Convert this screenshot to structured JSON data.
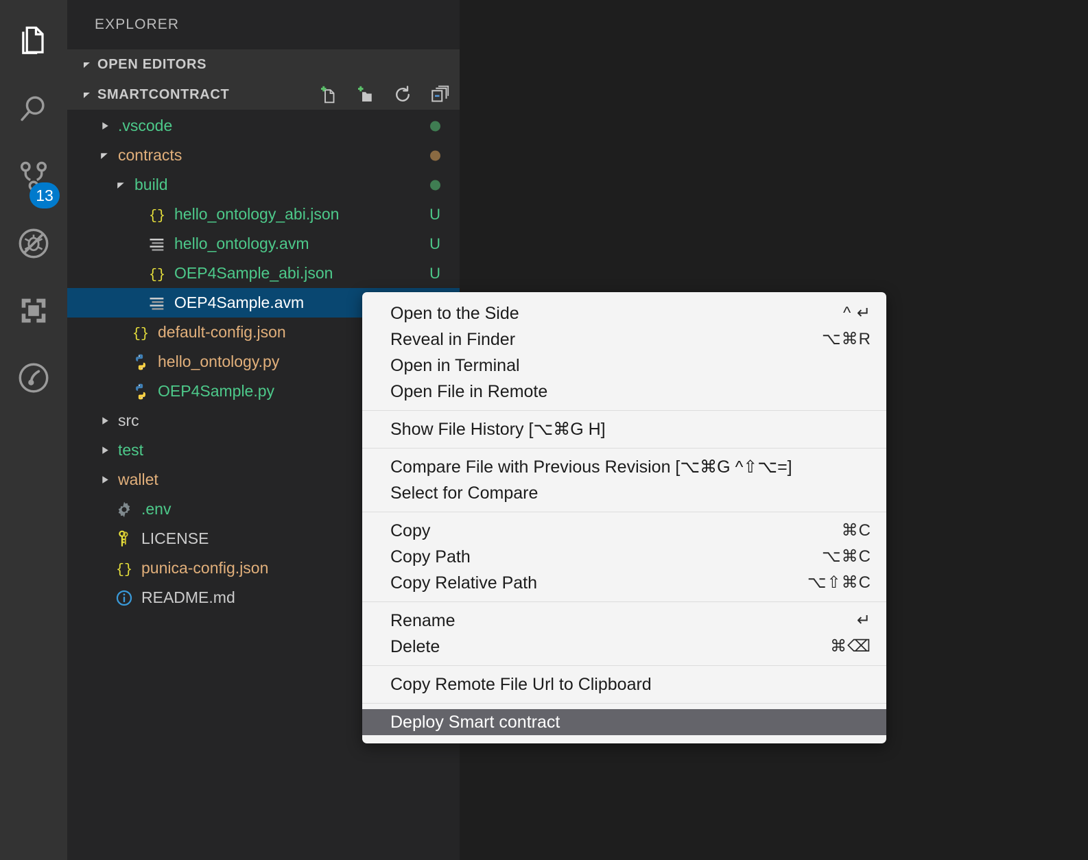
{
  "activitybar": {
    "items": [
      {
        "name": "explorer",
        "icon": "files-icon",
        "active": true
      },
      {
        "name": "search",
        "icon": "search-icon",
        "active": false
      },
      {
        "name": "source-control",
        "icon": "source-control-icon",
        "active": false,
        "badge": "13"
      },
      {
        "name": "run-and-debug",
        "icon": "debug-disabled-icon",
        "active": false
      },
      {
        "name": "extensions",
        "icon": "extensions-icon",
        "active": false
      },
      {
        "name": "git-graph",
        "icon": "git-graph-icon",
        "active": false
      }
    ]
  },
  "sidebar": {
    "title": "EXPLORER",
    "sections": [
      {
        "label": "OPEN EDITORS",
        "expanded": true
      },
      {
        "label": "SMARTCONTRACT",
        "expanded": true
      }
    ],
    "actions": [
      {
        "name": "new-file-button",
        "icon": "new-file-icon"
      },
      {
        "name": "new-folder-button",
        "icon": "new-folder-icon"
      },
      {
        "name": "refresh-button",
        "icon": "refresh-icon"
      },
      {
        "name": "collapse-all-button",
        "icon": "collapse-all-icon"
      }
    ],
    "tree": [
      {
        "label": ".vscode",
        "type": "folder",
        "state": "collapsed",
        "indent": 1,
        "color": "green",
        "icon": "none",
        "deco": "dot",
        "decoColor": "#3f7d52"
      },
      {
        "label": "contracts",
        "type": "folder",
        "state": "expanded",
        "indent": 1,
        "color": "orange",
        "icon": "none",
        "deco": "dot",
        "decoColor": "#8a6a42"
      },
      {
        "label": "build",
        "type": "folder",
        "state": "expanded",
        "indent": 2,
        "color": "green",
        "icon": "none",
        "deco": "dot",
        "decoColor": "#3f7d52"
      },
      {
        "label": "hello_ontology_abi.json",
        "type": "file",
        "state": "none",
        "indent": 3,
        "color": "green",
        "icon": "json-icon",
        "deco": "U",
        "decoColor": "#4dc98a"
      },
      {
        "label": "hello_ontology.avm",
        "type": "file",
        "state": "none",
        "indent": 3,
        "color": "green",
        "icon": "avm-icon",
        "deco": "U",
        "decoColor": "#4dc98a"
      },
      {
        "label": "OEP4Sample_abi.json",
        "type": "file",
        "state": "none",
        "indent": 3,
        "color": "green",
        "icon": "json-icon",
        "deco": "U",
        "decoColor": "#4dc98a"
      },
      {
        "label": "OEP4Sample.avm",
        "type": "file",
        "state": "none",
        "indent": 3,
        "color": "white",
        "icon": "avm-icon",
        "deco": "",
        "decoColor": "",
        "selected": true
      },
      {
        "label": "default-config.json",
        "type": "file",
        "state": "none",
        "indent": 2,
        "color": "orange",
        "icon": "json-icon",
        "deco": "",
        "decoColor": ""
      },
      {
        "label": "hello_ontology.py",
        "type": "file",
        "state": "none",
        "indent": 2,
        "color": "orange",
        "icon": "python-icon",
        "deco": "",
        "decoColor": ""
      },
      {
        "label": "OEP4Sample.py",
        "type": "file",
        "state": "none",
        "indent": 2,
        "color": "green",
        "icon": "python-icon",
        "deco": "",
        "decoColor": ""
      },
      {
        "label": "src",
        "type": "folder",
        "state": "collapsed",
        "indent": 1,
        "color": "grey",
        "icon": "none",
        "deco": "",
        "decoColor": ""
      },
      {
        "label": "test",
        "type": "folder",
        "state": "collapsed",
        "indent": 1,
        "color": "green",
        "icon": "none",
        "deco": "",
        "decoColor": ""
      },
      {
        "label": "wallet",
        "type": "folder",
        "state": "collapsed",
        "indent": 1,
        "color": "orange",
        "icon": "none",
        "deco": "",
        "decoColor": ""
      },
      {
        "label": ".env",
        "type": "file",
        "state": "none",
        "indent": 1,
        "color": "green",
        "icon": "gear-icon",
        "deco": "",
        "decoColor": ""
      },
      {
        "label": "LICENSE",
        "type": "file",
        "state": "none",
        "indent": 1,
        "color": "grey",
        "icon": "keys-icon",
        "deco": "",
        "decoColor": ""
      },
      {
        "label": "punica-config.json",
        "type": "file",
        "state": "none",
        "indent": 1,
        "color": "orange",
        "icon": "json-icon",
        "deco": "",
        "decoColor": ""
      },
      {
        "label": "README.md",
        "type": "file",
        "state": "none",
        "indent": 1,
        "color": "grey",
        "icon": "info-icon",
        "deco": "",
        "decoColor": ""
      }
    ]
  },
  "context_menu": {
    "groups": [
      {
        "items": [
          {
            "label": "Open to the Side",
            "shortcut": "^ ↵"
          },
          {
            "label": "Reveal in Finder",
            "shortcut": "⌥⌘R"
          },
          {
            "label": "Open in Terminal",
            "shortcut": ""
          },
          {
            "label": "Open File in Remote",
            "shortcut": ""
          }
        ]
      },
      {
        "items": [
          {
            "label": "Show File History [⌥⌘G H]",
            "shortcut": ""
          }
        ]
      },
      {
        "items": [
          {
            "label": "Compare File with Previous Revision [⌥⌘G ^⇧⌥=]",
            "shortcut": ""
          },
          {
            "label": "Select for Compare",
            "shortcut": ""
          }
        ]
      },
      {
        "items": [
          {
            "label": "Copy",
            "shortcut": "⌘C"
          },
          {
            "label": "Copy Path",
            "shortcut": "⌥⌘C"
          },
          {
            "label": "Copy Relative Path",
            "shortcut": "⌥⇧⌘C"
          }
        ]
      },
      {
        "items": [
          {
            "label": "Rename",
            "shortcut": "↵"
          },
          {
            "label": "Delete",
            "shortcut": "⌘⌫"
          }
        ]
      },
      {
        "items": [
          {
            "label": "Copy Remote File Url to Clipboard",
            "shortcut": ""
          }
        ]
      },
      {
        "items": [
          {
            "label": "Deploy Smart contract",
            "shortcut": "",
            "highlighted": true
          }
        ]
      }
    ]
  },
  "colors": {
    "activitybar_bg": "#333333",
    "sidebar_bg": "#252526",
    "editor_bg": "#1e1e1e",
    "selection_blue": "#094771",
    "badge_blue": "#007acc",
    "menu_bg": "#f4f4f4",
    "menu_highlight": "#64646a",
    "green_text": "#4dc98a",
    "orange_text": "#e2b07b"
  }
}
